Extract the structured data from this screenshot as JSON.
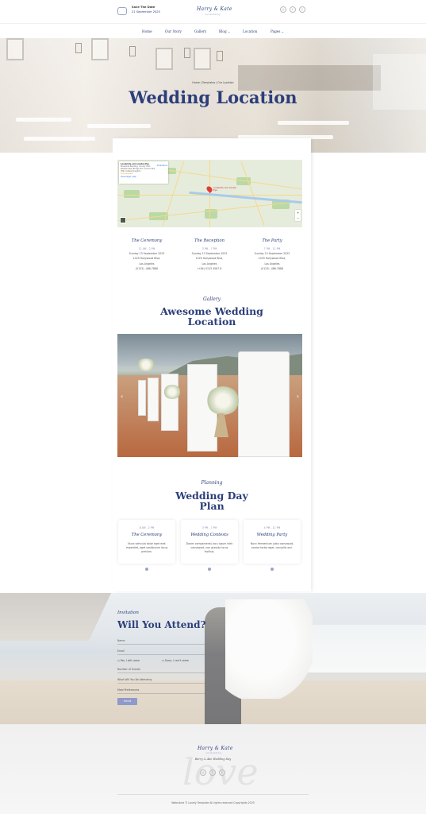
{
  "header": {
    "save_title": "Save The Date",
    "save_date": "21 September 2025",
    "logo": "Harry & Kate",
    "logo_sub": "ourwedding"
  },
  "nav": {
    "items": [
      {
        "label": "Home"
      },
      {
        "label": "Our Story"
      },
      {
        "label": "Gallery"
      },
      {
        "label": "Blog ⌄"
      },
      {
        "label": "Location"
      },
      {
        "label": "Pages ⌄"
      }
    ]
  },
  "hero": {
    "breadcrumb": "Home | Templates | Our Location",
    "title": "Wedding Location"
  },
  "map": {
    "place_name": "Lovebirds.com London Eye",
    "place_address": "Riverside Building, County Hall, Westminster Bridge Rd, London SE1 7PB, United Kingdom",
    "rating": "4.4 ★★★★★",
    "reviews": "73,824 reviews",
    "directions": "Directions",
    "larger_map": "View larger map",
    "marker_label": "Lovebirds.com London Eye",
    "zoom_in": "+",
    "zoom_out": "−"
  },
  "events": [
    {
      "title": "The Ceremony",
      "time": "11 AM - 2 PM",
      "date": "Sunday 13 September 2025",
      "address": "1029 Hollywood Blvd,",
      "city": "Los Angeles",
      "phone": "(0123) -486-7886"
    },
    {
      "title": "The Reception",
      "time": "3 PM - 7 PM",
      "date": "Sunday 13 September 2025",
      "address": "1029 Hollywood Blvd,",
      "city": "Los Angeles",
      "phone": "(+84) 0123 4567 8"
    },
    {
      "title": "The Party",
      "time": "7 PM - 11 PM",
      "date": "Sunday 13 September 2025",
      "address": "1029 Hollywood Blvd,",
      "city": "Los Angeles",
      "phone": "(0123) -486-7886"
    }
  ],
  "gallery": {
    "script": "Gallery",
    "title_line1": "Awesome Wedding",
    "title_line2": "Location",
    "prev": "‹",
    "next": "›"
  },
  "planning": {
    "script": "Planning",
    "title_line1": "Wedding Day",
    "title_line2": "Plan",
    "cards": [
      {
        "time": "8 AM - 2 PM",
        "title": "The Ceremony",
        "desc": "Nunc vehicula dolor eget erat imperdiet, eget vestibulum lacus pretium."
      },
      {
        "time": "3 PM - 7 PM",
        "title": "Wedding Contests",
        "desc": "Donec comparventu lacu ipsum nibh consequat, non gravida lacus facilisis."
      },
      {
        "time": "4 PM - 11 PM",
        "title": "Wedding Party",
        "desc": "Nunc fermentum justo consequat, ornare tortor eget, convallis orci."
      }
    ]
  },
  "rsvp": {
    "script": "Invitation",
    "title": "Will You Attend?",
    "name_placeholder": "Name",
    "email_placeholder": "Email",
    "yes_label": "Yes, I will come",
    "no_label": "Sorry, I can't come",
    "guests_placeholder": "Number of Guests",
    "event_placeholder": "What Will You Be Attending",
    "meal_placeholder": "Meal Preferences",
    "send_label": "Send"
  },
  "footer": {
    "logo": "Harry & Kate",
    "logo_sub": "ourwedding",
    "tagline": "Barry & Abe Wedding Day",
    "bg_text": "love",
    "copyright": "Websiture © Lovely Template All rights reserved Copyrights 2025"
  },
  "social": [
    "◎",
    "t",
    "f"
  ],
  "colors": {
    "accent": "#2c3e7a",
    "muted": "#8a91c0",
    "button": "#9099c9"
  }
}
